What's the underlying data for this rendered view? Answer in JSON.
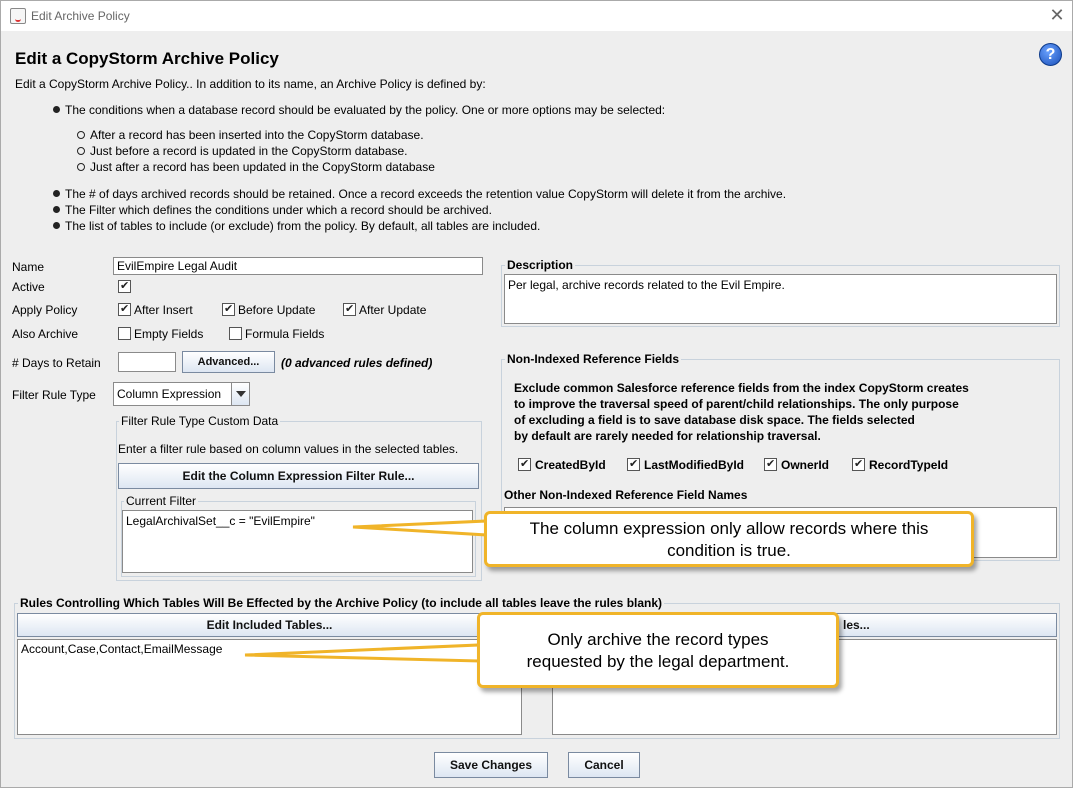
{
  "window": {
    "title": "Edit Archive Policy"
  },
  "header": {
    "title": "Edit a CopyStorm Archive Policy",
    "intro": "Edit a CopyStorm Archive Policy.. In addition to its name, an Archive Policy is defined by:",
    "bullets": [
      "The conditions when a database record should be evaluated by the policy. One or more options may be selected:",
      "The # of days archived records should be retained. Once a record exceeds the retention value CopyStorm will delete it from the archive.",
      "The Filter which defines the conditions under which a record should be archived.",
      "The list of tables to include (or exclude) from the policy. By default, all tables are included."
    ],
    "sub_options": [
      "After a record has been inserted into the CopyStorm database.",
      "Just before a record is updated in the CopyStorm database.",
      "Just after a record has been updated in the CopyStorm database"
    ]
  },
  "form": {
    "name_label": "Name",
    "name_value": "EvilEmpire Legal Audit",
    "active_label": "Active",
    "active_checked": true,
    "apply_label": "Apply Policy",
    "apply_options": [
      {
        "label": "After Insert",
        "checked": true
      },
      {
        "label": "Before Update",
        "checked": true
      },
      {
        "label": "After Update",
        "checked": true
      }
    ],
    "also_label": "Also Archive",
    "also_options": [
      {
        "label": "Empty Fields",
        "checked": false
      },
      {
        "label": "Formula Fields",
        "checked": false
      }
    ],
    "days_label": "# Days to Retain",
    "days_value": "",
    "advanced_button": "Advanced...",
    "advanced_note": "(0 advanced rules defined)",
    "filter_type_label": "Filter Rule Type",
    "filter_type_value": "Column Expression"
  },
  "custom_data": {
    "title": "Filter Rule Type Custom Data",
    "instructions": "Enter a filter rule based on column values in the selected tables.",
    "edit_button": "Edit the Column Expression Filter Rule...",
    "current_filter_title": "Current Filter",
    "current_filter_value": "LegalArchivalSet__c = \"EvilEmpire\""
  },
  "description": {
    "title": "Description",
    "value": "Per legal, archive records related to the Evil Empire."
  },
  "non_indexed": {
    "title": "Non-Indexed Reference Fields",
    "text_lines": [
      "Exclude common Salesforce reference fields from the index CopyStorm creates",
      "to improve the traversal speed of parent/child relationships. The only purpose",
      "of excluding a field is to save database disk space. The fields selected",
      "by default are rarely needed for relationship traversal."
    ],
    "fields": [
      {
        "label": "CreatedById",
        "checked": true
      },
      {
        "label": "LastModifiedById",
        "checked": true
      },
      {
        "label": "OwnerId",
        "checked": true
      },
      {
        "label": "RecordTypeId",
        "checked": true
      }
    ],
    "other_title": "Other Non-Indexed Reference Field Names"
  },
  "rules": {
    "title": "Rules Controlling Which Tables Will Be Effected by the Archive Policy (to include all tables leave the rules blank)",
    "included_button": "Edit Included Tables...",
    "included_value": "Account,Case,Contact,EmailMessage",
    "excluded_button_visible": "les..."
  },
  "callouts": {
    "filter": [
      "The column expression only allow records where this",
      "condition is true."
    ],
    "tables": [
      "Only archive the record types",
      "requested by the legal department."
    ]
  },
  "footer": {
    "save_label": "Save Changes",
    "cancel_label": "Cancel"
  }
}
